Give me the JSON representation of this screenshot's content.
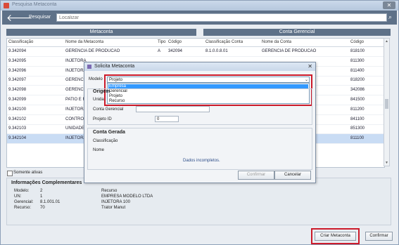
{
  "window": {
    "title": "Pesquisa Metaconta",
    "close": "✕"
  },
  "toolbar": {
    "back": "🡐",
    "search_label": "Pesquisar",
    "search_placeholder": "Localizar",
    "search_icon": "⌕"
  },
  "sections": {
    "metaconta": "Metaconta",
    "conta_gerencial": "Conta Gerencial"
  },
  "table": {
    "columns": [
      "Classificação",
      "Nome da Metaconta",
      "Tipo",
      "Código",
      "Classificação Conta",
      "Nome da Conta",
      "Código"
    ],
    "rows": [
      [
        "9.342094",
        "GERENCIA DE PRODUCAO",
        "A",
        "342094",
        "8.1.0.0.8.01",
        "GERENCIA DE PRODUCAO",
        "818100"
      ],
      [
        "9.342095",
        "INJETORA",
        "",
        "",
        "",
        "",
        "811300"
      ],
      [
        "9.342096",
        "INJETORA",
        "",
        "",
        "",
        "",
        "811400"
      ],
      [
        "9.342097",
        "GERENCIA",
        "",
        "",
        "",
        "",
        "818200"
      ],
      [
        "9.342098",
        "GERENCIA",
        "",
        "",
        "",
        "",
        "342086"
      ],
      [
        "9.342099",
        "PATIO E R",
        "",
        "",
        "",
        "",
        "841500"
      ],
      [
        "9.342100",
        "INJETORA",
        "",
        "",
        "",
        "",
        "811200"
      ],
      [
        "9.342102",
        "CONTROLA",
        "",
        "",
        "",
        "",
        "841100"
      ],
      [
        "9.342103",
        "UNIDADE C",
        "",
        "",
        "",
        "",
        "851300"
      ],
      [
        "9.342104",
        "INJETORA",
        "",
        "",
        "",
        "",
        "811100"
      ]
    ],
    "selected_index": 9
  },
  "somente_ativas": "Somente ativas",
  "info": {
    "title": "Informações Complementares",
    "rows": [
      {
        "k": "Modelo:",
        "v": "2",
        "d": "Recurso"
      },
      {
        "k": "UN:",
        "v": "1",
        "d": "EMPRESA MODELO LTDA"
      },
      {
        "k": "Gerencial:",
        "v": "8.1.001.01",
        "d": "INJETORA 100"
      },
      {
        "k": "Recurso:",
        "v": "70",
        "d": "Trator Manut"
      }
    ]
  },
  "buttons": {
    "criar": "Criar Metaconta",
    "confirmar": "Confirmar"
  },
  "dialog": {
    "title": "Solicita Metaconta",
    "modelo_label": "Modelo",
    "modelo_value": "Projeto",
    "options": [
      "Empresa",
      "Gerencial",
      "Projeto",
      "Recurso"
    ],
    "highlighted_option": 0,
    "origem_label": "Origem",
    "unidade_label": "Unida",
    "conta_gerencial_label": "Conta Gerencial",
    "projeto_id_label": "Projeto ID",
    "projeto_id_value": "0",
    "conta_gerada_label": "Conta Gerada",
    "classificacao_label": "Classificação",
    "nome_label": "Nome",
    "message": "Dados incompletos.",
    "confirmar": "Confirmar",
    "cancelar": "Cancelar"
  },
  "colors": {
    "accent": "#5e7188",
    "highlight": "#cc1a2a",
    "selected_row": "#c9dcf4",
    "option_highlight": "#3399ff"
  }
}
